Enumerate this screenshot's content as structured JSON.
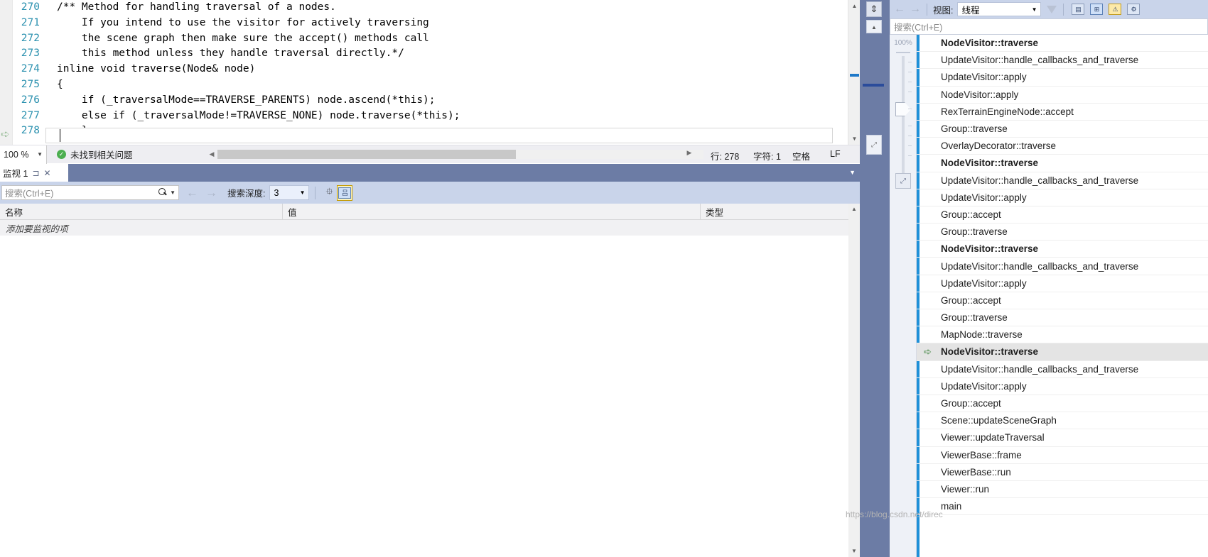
{
  "editor": {
    "lines": [
      {
        "num": "270",
        "text": "/** Method for handling traversal of a nodes."
      },
      {
        "num": "271",
        "text": "    If you intend to use the visitor for actively traversing"
      },
      {
        "num": "272",
        "text": "    the scene graph then make sure the accept() methods call"
      },
      {
        "num": "273",
        "text": "    this method unless they handle traversal directly.*/"
      },
      {
        "num": "274",
        "text": "inline void traverse(Node& node)"
      },
      {
        "num": "275",
        "text": "{"
      },
      {
        "num": "276",
        "text": "    if (_traversalMode==TRAVERSE_PARENTS) node.ascend(*this);"
      },
      {
        "num": "277",
        "text": "    else if (_traversalMode!=TRAVERSE_NONE) node.traverse(*this);"
      },
      {
        "num": "278",
        "text": "    }"
      }
    ],
    "status": {
      "zoom": "100 %",
      "issues": "未找到相关问题",
      "line": "行: 278",
      "char": "字符: 1",
      "indent": "空格",
      "eol": "LF"
    }
  },
  "watch": {
    "tab_label": "监视 1",
    "pin_icon": "pin-icon",
    "close_icon": "close-icon",
    "search_placeholder": "搜索(Ctrl+E)",
    "depth_label": "搜索深度:",
    "depth_value": "3",
    "columns": [
      "名称",
      "值",
      "类型"
    ],
    "empty_row": "添加要监视的项",
    "rows": []
  },
  "callstack": {
    "view_label": "视图:",
    "view_value": "线程",
    "search_placeholder": "搜索(Ctrl+E)",
    "zoom_pct": "100%",
    "frames": [
      {
        "name": "NodeVisitor::traverse",
        "bold": true,
        "current": false,
        "marker": ""
      },
      {
        "name": "UpdateVisitor::handle_callbacks_and_traverse",
        "bold": false,
        "current": false,
        "marker": ""
      },
      {
        "name": "UpdateVisitor::apply",
        "bold": false,
        "current": false,
        "marker": ""
      },
      {
        "name": "NodeVisitor::apply",
        "bold": false,
        "current": false,
        "marker": ""
      },
      {
        "name": "RexTerrainEngineNode::accept",
        "bold": false,
        "current": false,
        "marker": ""
      },
      {
        "name": "Group::traverse",
        "bold": false,
        "current": false,
        "marker": ""
      },
      {
        "name": "OverlayDecorator::traverse",
        "bold": false,
        "current": false,
        "marker": ""
      },
      {
        "name": "NodeVisitor::traverse",
        "bold": true,
        "current": false,
        "marker": ""
      },
      {
        "name": "UpdateVisitor::handle_callbacks_and_traverse",
        "bold": false,
        "current": false,
        "marker": ""
      },
      {
        "name": "UpdateVisitor::apply",
        "bold": false,
        "current": false,
        "marker": ""
      },
      {
        "name": "Group::accept",
        "bold": false,
        "current": false,
        "marker": ""
      },
      {
        "name": "Group::traverse",
        "bold": false,
        "current": false,
        "marker": ""
      },
      {
        "name": "NodeVisitor::traverse",
        "bold": true,
        "current": false,
        "marker": ""
      },
      {
        "name": "UpdateVisitor::handle_callbacks_and_traverse",
        "bold": false,
        "current": false,
        "marker": ""
      },
      {
        "name": "UpdateVisitor::apply",
        "bold": false,
        "current": false,
        "marker": ""
      },
      {
        "name": "Group::accept",
        "bold": false,
        "current": false,
        "marker": ""
      },
      {
        "name": "Group::traverse",
        "bold": false,
        "current": false,
        "marker": ""
      },
      {
        "name": "MapNode::traverse",
        "bold": false,
        "current": false,
        "marker": ""
      },
      {
        "name": "NodeVisitor::traverse",
        "bold": true,
        "current": true,
        "marker": "➪"
      },
      {
        "name": "UpdateVisitor::handle_callbacks_and_traverse",
        "bold": false,
        "current": false,
        "marker": ""
      },
      {
        "name": "UpdateVisitor::apply",
        "bold": false,
        "current": false,
        "marker": ""
      },
      {
        "name": "Group::accept",
        "bold": false,
        "current": false,
        "marker": ""
      },
      {
        "name": "Scene::updateSceneGraph",
        "bold": false,
        "current": false,
        "marker": ""
      },
      {
        "name": "Viewer::updateTraversal",
        "bold": false,
        "current": false,
        "marker": ""
      },
      {
        "name": "ViewerBase::frame",
        "bold": false,
        "current": false,
        "marker": ""
      },
      {
        "name": "ViewerBase::run",
        "bold": false,
        "current": false,
        "marker": ""
      },
      {
        "name": "Viewer::run",
        "bold": false,
        "current": false,
        "marker": ""
      },
      {
        "name": "main",
        "bold": false,
        "current": false,
        "marker": ""
      }
    ]
  },
  "watermark": "https://blog.csdn.net/direc"
}
